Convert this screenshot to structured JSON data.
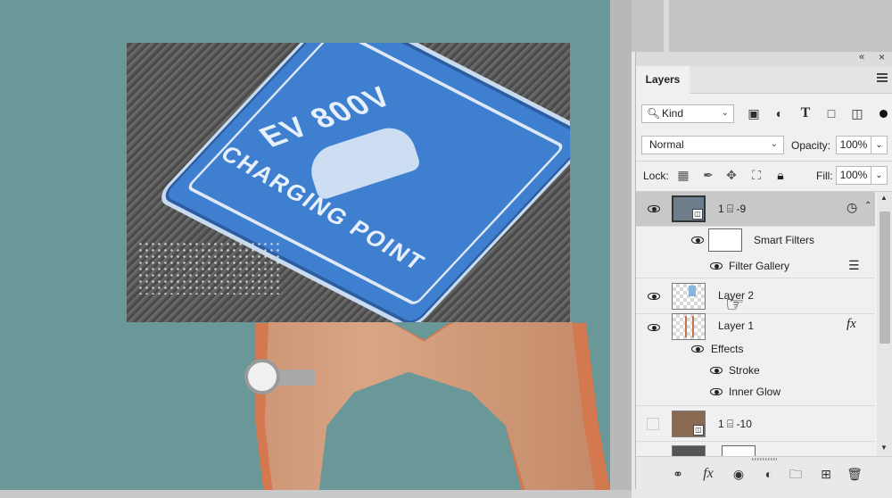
{
  "canvas": {
    "photo_sign_top": "EV 800V",
    "photo_sign_bottom": "CHARGING POINT"
  },
  "panel": {
    "collapse_icon": "«",
    "close_icon": "×",
    "tab": "Layers",
    "filter": {
      "kind_label": "Kind",
      "icons": [
        "image-filter-icon",
        "adjustment-filter-icon",
        "type-filter-icon",
        "shape-filter-icon",
        "smart-object-filter-icon"
      ]
    },
    "blend": {
      "mode": "Normal",
      "opacity_label": "Opacity:",
      "opacity_value": "100%"
    },
    "lock": {
      "label": "Lock:",
      "icons": [
        "lock-transparent-pixels-icon",
        "lock-image-pixels-icon",
        "lock-position-icon",
        "lock-artboard-icon",
        "lock-all-icon"
      ],
      "fill_label": "Fill:",
      "fill_value": "100%"
    },
    "layers": [
      {
        "name": "1 ⌸ -9",
        "visible": true,
        "type": "smart-object",
        "selected": true
      },
      {
        "name": "Smart Filters",
        "visible": true,
        "type": "smart-filters"
      },
      {
        "name": "Filter Gallery",
        "visible": true,
        "type": "filter"
      },
      {
        "name": "Layer 2",
        "visible": true,
        "type": "pixel"
      },
      {
        "name": "Layer 1",
        "visible": true,
        "type": "pixel",
        "fx": "fx"
      },
      {
        "name": "Effects",
        "visible": true,
        "type": "effects"
      },
      {
        "name": "Stroke",
        "visible": true,
        "type": "effect"
      },
      {
        "name": "Inner Glow",
        "visible": true,
        "type": "effect"
      },
      {
        "name": "1 ⌸ -10",
        "visible": false,
        "type": "smart-object"
      }
    ],
    "footer_icons": [
      "link-layers-icon",
      "add-layer-style-icon",
      "add-mask-icon",
      "adjustment-layer-icon",
      "new-group-icon",
      "new-layer-icon",
      "delete-layer-icon"
    ]
  }
}
